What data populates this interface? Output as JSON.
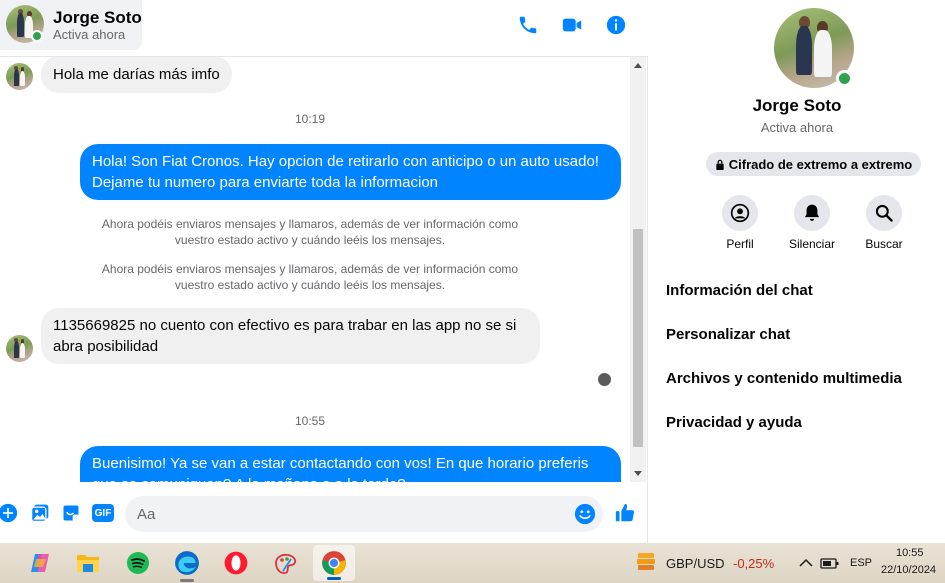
{
  "header": {
    "name": "Jorge Soto",
    "status": "Activa ahora",
    "icons": [
      "phone-icon",
      "video-icon",
      "info-icon"
    ],
    "accent": "#0084ff"
  },
  "messages": {
    "incoming_1": "Hola me darías más imfo",
    "time_1": "10:19",
    "outgoing_1": "Hola! Son Fiat Cronos. Hay opcion de retirarlo con anticipo o un auto usado! Dejame tu numero para enviarte toda la informacion",
    "system_1": "Ahora podéis enviaros mensajes y llamaros, además de ver información como vuestro estado activo y cuándo leéis los mensajes.",
    "system_2": "Ahora podéis enviaros mensajes y llamaros, además de ver información como vuestro estado activo y cuándo leéis los mensajes.",
    "incoming_2": "1135669825 no cuento con efectivo es para trabar en las app no se si abra posibilidad",
    "time_2": "10:55",
    "outgoing_2": "Buenisimo! Ya se van a estar contactando con vos! En que horario preferis que se comuniquen? A la mañana o a la tarde?"
  },
  "composer": {
    "placeholder": "Aa",
    "icons": [
      "plus-icon",
      "image-icon",
      "sticker-icon",
      "gif-icon",
      "emoji-icon",
      "like-icon"
    ],
    "gif_label": "GIF"
  },
  "info_panel": {
    "name": "Jorge Soto",
    "status": "Activa ahora",
    "encryption": "Cifrado de extremo a extremo",
    "actions": [
      {
        "label": "Perfil",
        "icon": "profile-icon"
      },
      {
        "label": "Silenciar",
        "icon": "bell-icon"
      },
      {
        "label": "Buscar",
        "icon": "search-icon"
      }
    ],
    "menu": [
      "Información del chat",
      "Personalizar chat",
      "Archivos y contenido multimedia",
      "Privacidad y ayuda"
    ]
  },
  "taskbar": {
    "apps": [
      "copilot-icon",
      "file-explorer-icon",
      "spotify-icon",
      "edge-icon",
      "opera-icon",
      "paint-icon",
      "chrome-icon"
    ],
    "ticker_label": "GBP/USD",
    "ticker_value": "-0,25%",
    "ticker_color": "#c42b1c",
    "language": "ESP",
    "time": "10:55",
    "date": "22/10/2024"
  }
}
